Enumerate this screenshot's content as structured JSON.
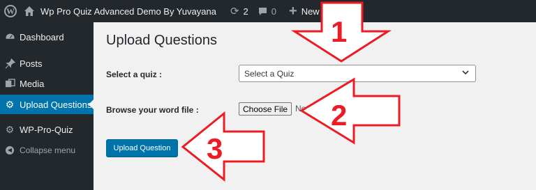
{
  "admin_bar": {
    "site_name": "Wp Pro Quiz Advanced Demo By Yuvayana",
    "updates_count": "2",
    "comments_count": "0",
    "new_label": "New"
  },
  "sidebar": {
    "items": [
      {
        "label": "Dashboard",
        "icon": "dashboard-icon"
      },
      {
        "label": "Posts",
        "icon": "pin-icon"
      },
      {
        "label": "Media",
        "icon": "media-icon"
      },
      {
        "label": "Upload Questions",
        "icon": "gear-icon",
        "current": true
      },
      {
        "label": "WP-Pro-Quiz",
        "icon": "gear-icon"
      },
      {
        "label": "Collapse menu",
        "icon": "collapse-icon"
      }
    ]
  },
  "main": {
    "title": "Upload Questions",
    "quiz_label": "Select a quiz :",
    "quiz_select_value": "Select a Quiz",
    "file_label": "Browse your word file :",
    "choose_file_label": "Choose File",
    "no_file_text": "No file chosen",
    "upload_button_label": "Upload Question"
  },
  "annotations": {
    "step1": "1",
    "step2": "2",
    "step3": "3",
    "color": "#ed1c24"
  },
  "colors": {
    "admin_dark": "#23282d",
    "accent_blue": "#0073aa",
    "background": "#f1f1f1"
  }
}
